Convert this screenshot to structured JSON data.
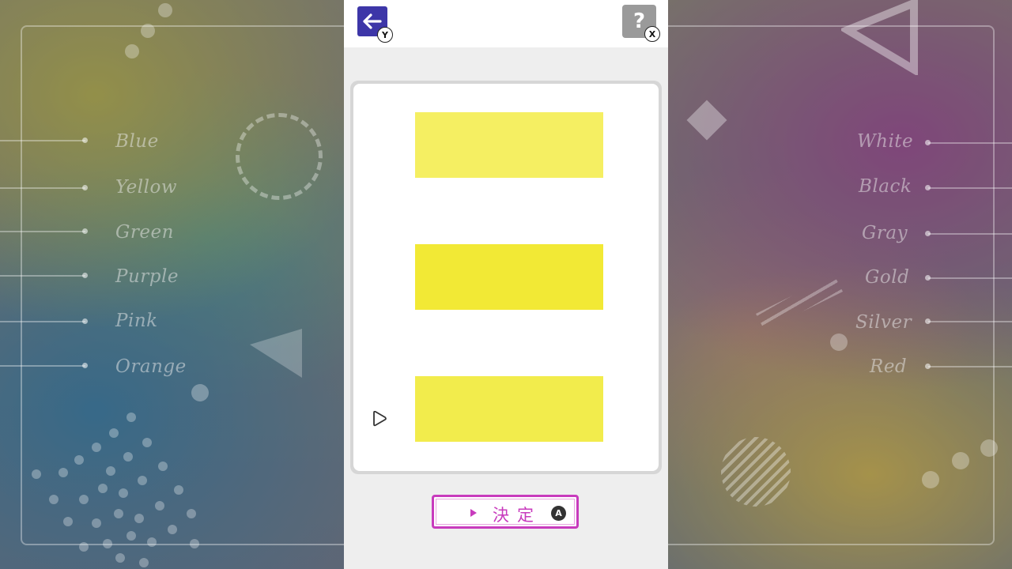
{
  "left_colors": [
    "Blue",
    "Yellow",
    "Green",
    "Purple",
    "Pink",
    "Orange"
  ],
  "right_colors": [
    "White",
    "Black",
    "Gray",
    "Gold",
    "Silver",
    "Red"
  ],
  "header": {
    "back_icon": "arrow-left-icon",
    "back_badge": "Y",
    "help_label": "?",
    "help_badge": "X"
  },
  "swatches": [
    {
      "color": "#f5ef62"
    },
    {
      "color": "#f2e935"
    },
    {
      "color": "#f2ec4c"
    }
  ],
  "selection_cursor_icon": "hand-pointer-icon",
  "confirm": {
    "label": "決定",
    "badge": "A",
    "accent": "#c83bbd"
  }
}
